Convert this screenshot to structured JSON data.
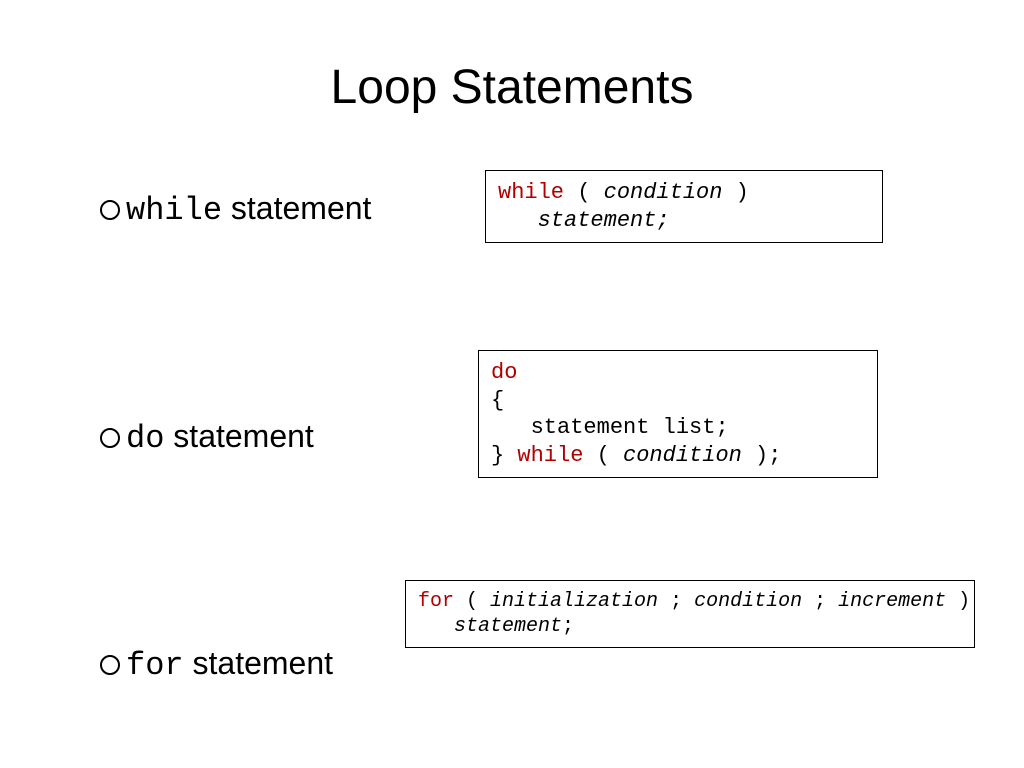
{
  "title": "Loop Statements",
  "bullets": {
    "while_kw": "while",
    "while_rest": " statement",
    "do_kw": "do",
    "do_rest": " statement",
    "for_kw": "for",
    "for_rest": " statement"
  },
  "code": {
    "while": {
      "kw_while": "while",
      "open": " ( ",
      "cond": "condition",
      "close": " )",
      "indent": "   ",
      "stmt": "statement;"
    },
    "do": {
      "kw_do": "do",
      "lbrace": "{",
      "body_indent": "   ",
      "body": "statement list;",
      "rbrace": "} ",
      "kw_while": "while",
      "open": " ( ",
      "cond": "condition",
      "close": " );"
    },
    "for": {
      "kw_for": "for",
      "open": " ( ",
      "init": "initialization",
      "sep1": " ; ",
      "cond": "condition",
      "sep2": " ; ",
      "incr": "increment",
      "close": " )",
      "indent": "   ",
      "stmt": "statement",
      "semi": ";"
    }
  }
}
